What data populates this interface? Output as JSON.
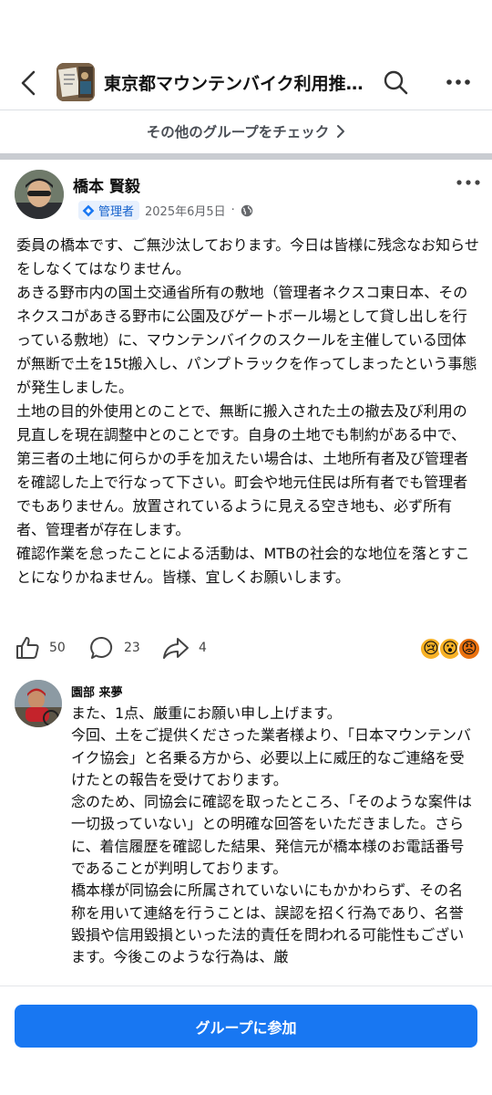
{
  "header": {
    "group_title": "東京都マウンテンバイク利用推進協議会",
    "back_icon": "chevron-left-icon",
    "search_icon": "search-icon",
    "more_icon": "more-horizontal-icon"
  },
  "banner": {
    "check_other_groups": "その他のグループをチェック"
  },
  "post": {
    "author": "橋本 賢毅",
    "role_badge": "管理者",
    "date": "2025年6月5日",
    "separator": "·",
    "paragraphs": [
      "委員の橋本です、ご無沙汰しております。今日は皆様に残念なお知らせをしなくてはなりません。",
      "あきる野市内の国土交通省所有の敷地（管理者ネクスコ東日本、そのネクスコがあきる野市に公園及びゲートボール場として貸し出しを行っている敷地）に、マウンテンバイクのスクールを主催している団体が無断で土を15t搬入し、パンプトラックを作ってしまったという事態が発生しました。",
      "土地の目的外使用とのことで、無断に搬入された土の撤去及び利用の見直しを現在調整中とのことです。自身の土地でも制約がある中で、第三者の土地に何らかの手を加えたい場合は、土地所有者及び管理者を確認した上で行なって下さい。町会や地元住民は所有者でも管理者でもありません。放置されているように見える空き地も、必ず所有者、管理者が存在します。",
      "確認作業を怠ったことによる活動は、MTBの社会的な地位を落とすことになりかねません。皆様、宜しくお願いします。"
    ],
    "likes": "50",
    "comments": "23",
    "shares": "4",
    "reactions": [
      "sad",
      "wow",
      "angry"
    ]
  },
  "comment": {
    "author": "園部 来夢",
    "paragraphs": [
      "また、1点、厳重にお願い申し上げます。",
      "今回、土をご提供くださった業者様より、「日本マウンテンバイク協会」と名乗る方から、必要以上に威圧的なご連絡を受けたとの報告を受けております。",
      "念のため、同協会に確認を取ったところ、「そのような案件は一切扱っていない」との明確な回答をいただきました。さらに、着信履歴を確認した結果、発信元が橋本様のお電話番号であることが判明しております。",
      "橋本様が同協会に所属されていないにもかかわらず、その名称を用いて連絡を行うことは、誤認を招く行為であり、名誉毀損や信用毀損といった法的責任を問われる可能性もございます。今後このような行為は、厳"
    ]
  },
  "footer": {
    "join_button": "グループに参加"
  },
  "colors": {
    "accent": "#1877f2",
    "badge_bg": "#e7f0fd",
    "badge_text": "#1461cc",
    "band": "#c9ccd1"
  }
}
